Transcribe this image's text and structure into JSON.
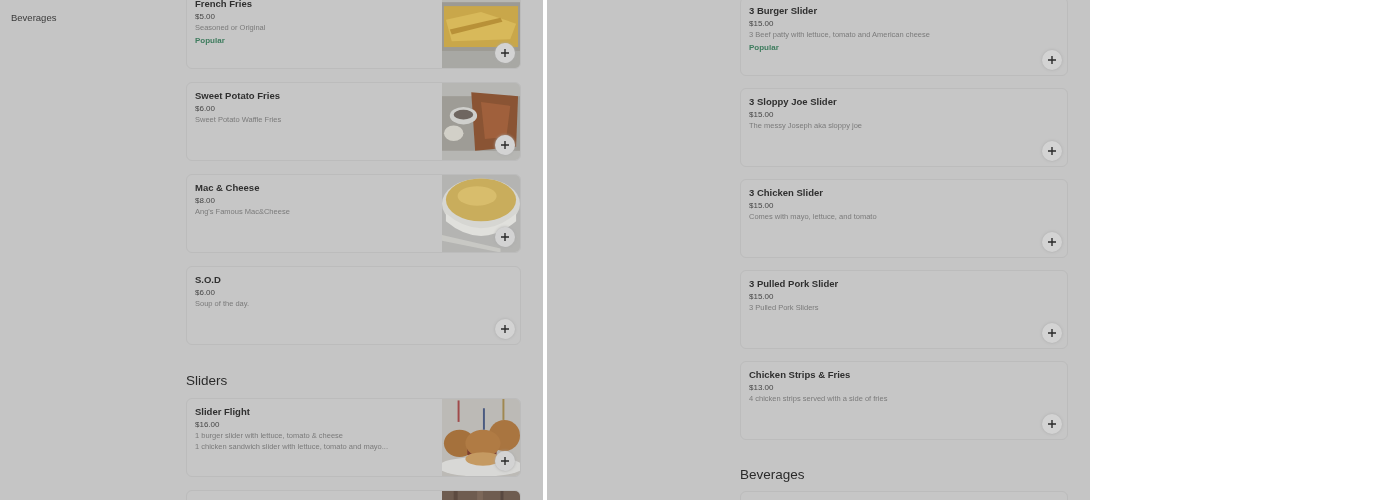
{
  "panels": [
    {
      "sidebar": [
        {
          "label": "Beverages"
        }
      ],
      "sections": [
        {
          "items": [
            {
              "title": "French Fries",
              "price": "$5.00",
              "description": [
                "Seasoned or Original"
              ],
              "tag": "Popular",
              "kind": "fries"
            },
            {
              "title": "Sweet Potato Fries",
              "price": "$6.00",
              "description": [
                "Sweet Potato Waffle Fries"
              ],
              "kind": "waffles"
            },
            {
              "title": "Mac & Cheese",
              "price": "$8.00",
              "description": [
                "Ang's Famous Mac&Cheese"
              ],
              "kind": "bowl"
            },
            {
              "title": "S.O.D",
              "price": "$6.00",
              "description": [
                "Soup of the day."
              ],
              "kind": "plain"
            }
          ]
        },
        {
          "heading": "Sliders",
          "items": [
            {
              "title": "Slider Flight",
              "price": "$16.00",
              "description": [
                "1 burger slider with lettuce, tomato & cheese",
                "1 chicken sandwich slider with lettuce, tomato and mayo..."
              ],
              "kind": "sliders"
            },
            {
              "kind": "wood"
            }
          ]
        }
      ]
    },
    {
      "sections": [
        {
          "items": [
            {
              "title": "3 Burger Slider",
              "price": "$15.00",
              "description": [
                "3 Beef patty with lettuce, tomato and American cheese"
              ],
              "tag": "Popular",
              "kind": "plain"
            },
            {
              "title": "3 Sloppy Joe Slider",
              "price": "$15.00",
              "description": [
                "The messy Joseph aka sloppy joe"
              ],
              "kind": "plain"
            },
            {
              "title": "3 Chicken Slider",
              "price": "$15.00",
              "description": [
                "Comes with mayo, lettuce, and tomato"
              ],
              "kind": "plain"
            },
            {
              "title": "3 Pulled Pork Slider",
              "price": "$15.00",
              "description": [
                "3 Pulled Pork Sliders"
              ],
              "kind": "plain"
            },
            {
              "title": "Chicken Strips & Fries",
              "price": "$13.00",
              "description": [
                "4 chicken strips served with a side of fries"
              ],
              "kind": "plain"
            }
          ]
        },
        {
          "heading": "Beverages",
          "items": [
            {
              "kind": "plain"
            }
          ]
        }
      ]
    }
  ]
}
